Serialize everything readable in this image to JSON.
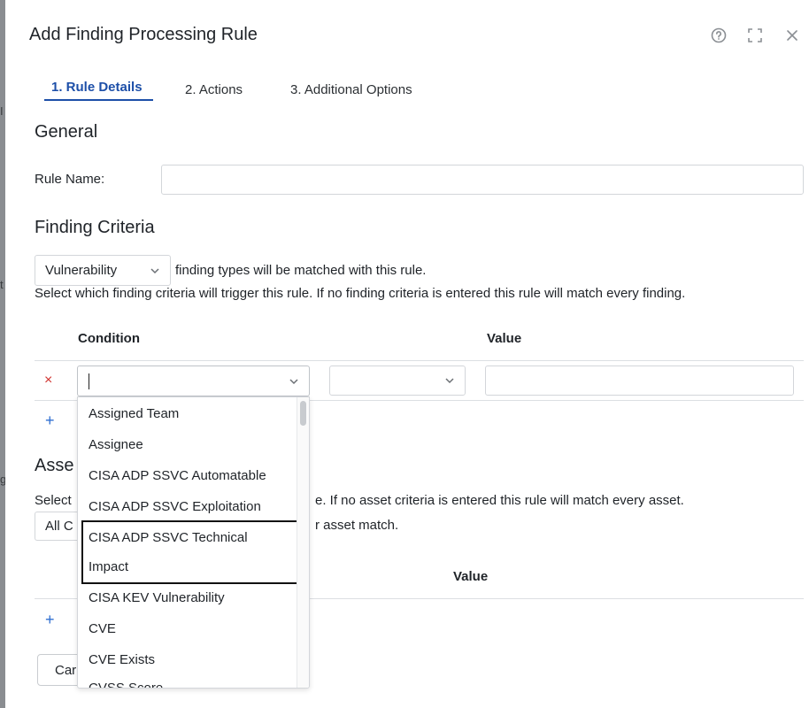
{
  "dialog": {
    "title": "Add Finding Processing Rule",
    "icons": {
      "help": "help-circle-icon",
      "expand": "expand-icon",
      "close": "close-icon"
    }
  },
  "tabs": [
    {
      "label": "1. Rule Details",
      "active": true
    },
    {
      "label": "2. Actions",
      "active": false
    },
    {
      "label": "3. Additional Options",
      "active": false
    }
  ],
  "general": {
    "title": "General",
    "rule_name_label": "Rule Name:",
    "rule_name_value": ""
  },
  "finding_criteria": {
    "title": "Finding Criteria",
    "type_select_value": "Vulnerability",
    "type_suffix": "finding types will be matched with this rule.",
    "description": "Select which finding criteria will trigger this rule. If no finding criteria is entered this rule will match every finding.",
    "col_condition": "Condition",
    "col_value": "Value",
    "remove_symbol": "×",
    "add_symbol": "+"
  },
  "asset_criteria": {
    "title_partial": "Asse",
    "description_prefix": "Select",
    "description_suffix": "e. If no asset criteria is entered this rule will match every asset.",
    "match_select_partial": "All C",
    "match_suffix": "r asset match.",
    "col_value": "Value",
    "add_symbol": "+"
  },
  "condition_dropdown": {
    "options": [
      "Assigned Team",
      "Assignee",
      "CISA ADP SSVC Automatable",
      "CISA ADP SSVC Exploitation",
      "CISA ADP SSVC Technical",
      "Impact",
      "CISA KEV Vulnerability",
      "CVE",
      "CVE Exists",
      "CVSS Score"
    ],
    "focused_option": "CISA ADP SSVC Technical Impact"
  },
  "footer": {
    "cancel_partial": "Car"
  },
  "colors": {
    "accent": "#1d4fa8",
    "remove": "#d0312d",
    "add": "#2f6fd1"
  }
}
